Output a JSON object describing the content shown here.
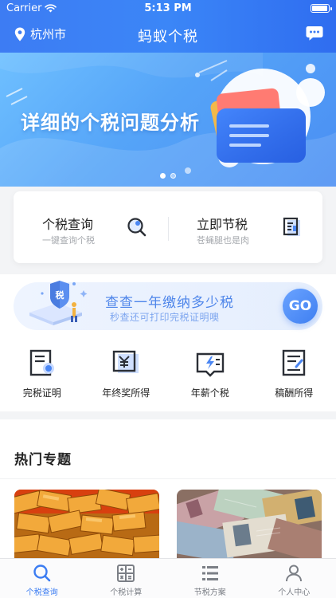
{
  "status_bar": {
    "carrier": "Carrier",
    "time": "5:13 PM"
  },
  "nav": {
    "location": "杭州市",
    "title": "蚂蚁个税"
  },
  "banner": {
    "headline": "详细的个税问题分析",
    "page_count": 2,
    "active_page": 1
  },
  "quick": {
    "left": {
      "title": "个税查询",
      "subtitle": "一键查询个税",
      "icon": "search-icon"
    },
    "right": {
      "title": "立即节税",
      "subtitle": "苍蝇腿也是肉",
      "icon": "document-icon"
    }
  },
  "promo": {
    "badge": "税",
    "title": "查查一年缴纳多少税",
    "subtitle": "秒查还可打印完税证明噢",
    "go_label": "GO"
  },
  "grid": [
    {
      "label": "完税证明",
      "icon": "certificate-icon"
    },
    {
      "label": "年终奖所得",
      "icon": "bonus-icon"
    },
    {
      "label": "年薪个税",
      "icon": "salary-icon"
    },
    {
      "label": "稿酬所得",
      "icon": "manuscript-icon"
    }
  ],
  "hot": {
    "title": "热门专题"
  },
  "tabbar": [
    {
      "label": "个税查询",
      "icon": "search-icon",
      "active": true
    },
    {
      "label": "个税计算",
      "icon": "calculator-icon",
      "active": false
    },
    {
      "label": "节税方案",
      "icon": "list-icon",
      "active": false
    },
    {
      "label": "个人中心",
      "icon": "person-icon",
      "active": false
    }
  ],
  "colors": {
    "primary": "#3b7cf2",
    "text": "#222222",
    "muted": "#a6a9ae"
  }
}
